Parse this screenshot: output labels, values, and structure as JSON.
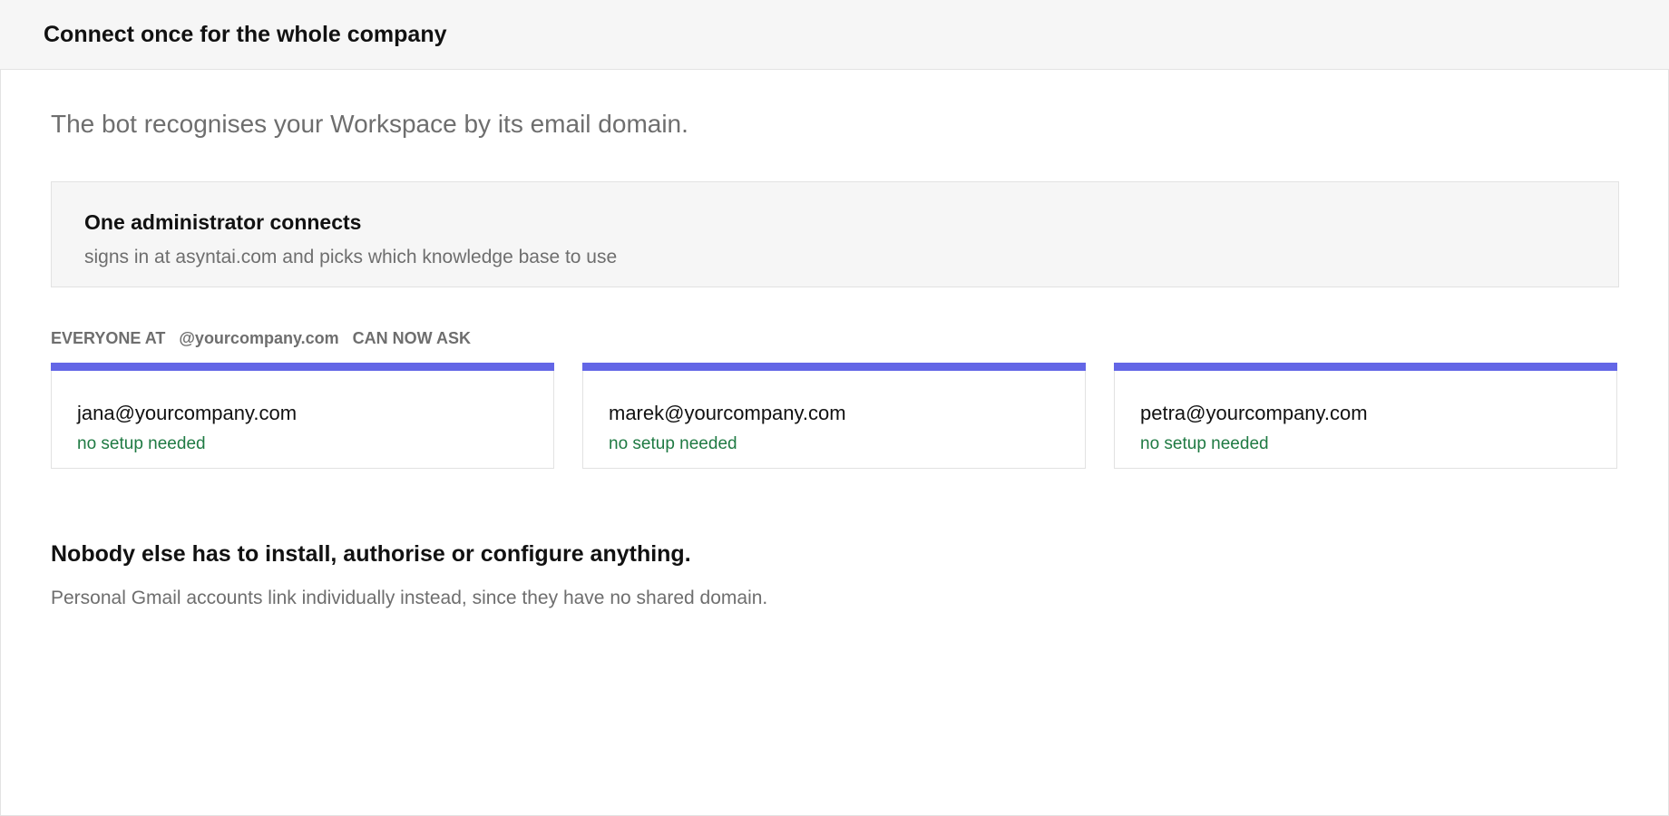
{
  "header": {
    "title": "Connect once for the whole company"
  },
  "main": {
    "subtitle": "The bot recognises your Workspace by its email domain.",
    "admin_box": {
      "title": "One administrator connects",
      "description": "signs in at asyntai.com and picks which knowledge base to use"
    },
    "everyone_line": {
      "prefix": "EVERYONE AT",
      "domain": "@yourcompany.com",
      "suffix": "CAN NOW ASK"
    },
    "users": [
      {
        "email": "jana@yourcompany.com",
        "status": "no setup needed"
      },
      {
        "email": "marek@yourcompany.com",
        "status": "no setup needed"
      },
      {
        "email": "petra@yourcompany.com",
        "status": "no setup needed"
      }
    ],
    "footnote": {
      "title": "Nobody else has to install, authorise or configure anything.",
      "description": "Personal Gmail accounts link individually instead, since they have no shared domain."
    }
  },
  "colors": {
    "accent": "#6366e6",
    "status_green": "#1f7a43",
    "muted_text": "#6e6e6e",
    "panel_background": "#f6f6f6"
  }
}
